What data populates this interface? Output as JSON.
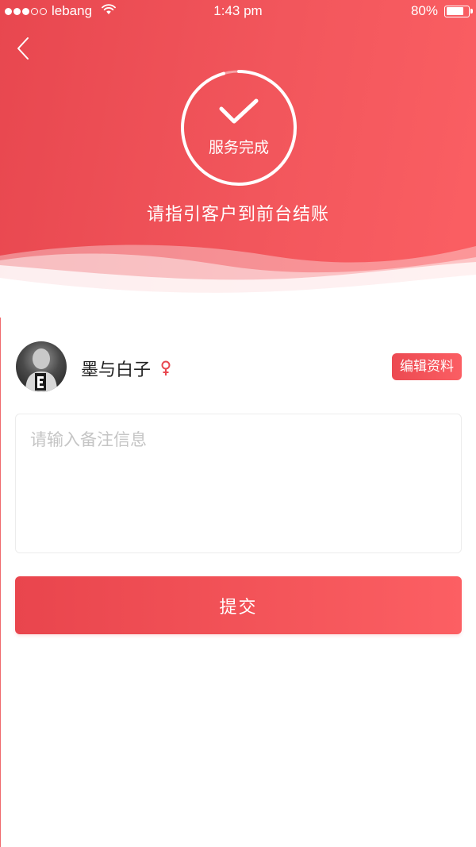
{
  "status_bar": {
    "carrier": "lebang",
    "time": "1:43 pm",
    "battery": "80%",
    "battery_level": 0.8,
    "signal_dots_filled": 3,
    "signal_dots_total": 5
  },
  "header": {
    "back_icon": "chevron-left-icon",
    "status_label": "服务完成",
    "status_icon": "checkmark-icon",
    "guide_text": "请指引客户到前台结账",
    "gradient_start": "#e8474f",
    "gradient_end": "#fb5f63"
  },
  "user": {
    "name": "墨与白子",
    "gender_icon": "female-icon",
    "gender_color": "#e8474f",
    "edit_label": "编辑资料"
  },
  "note": {
    "placeholder": "请输入备注信息",
    "value": ""
  },
  "submit": {
    "label": "提交"
  }
}
